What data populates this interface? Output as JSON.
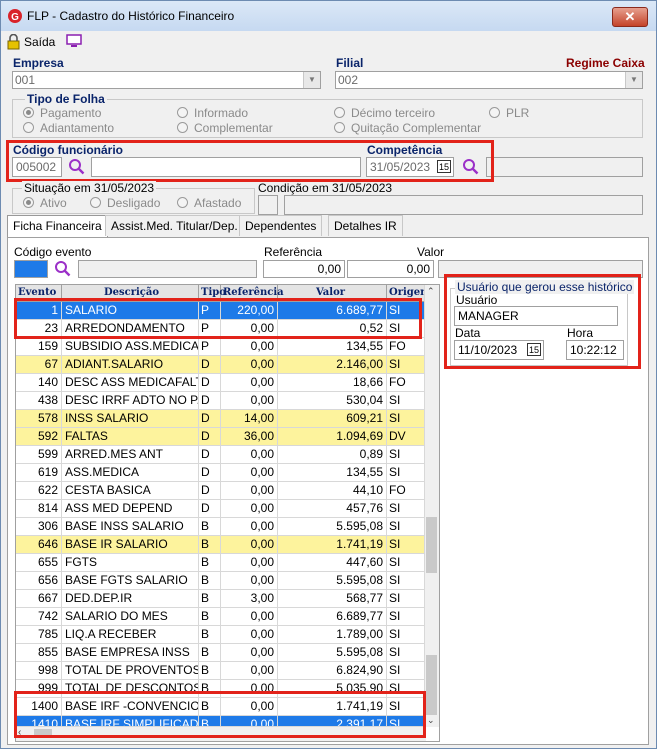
{
  "window": {
    "title": "FLP - Cadastro do Histórico Financeiro",
    "close_label": "✕"
  },
  "toolbar": {
    "exit_label": "Saída"
  },
  "empresa": {
    "label": "Empresa",
    "value": "001"
  },
  "filial": {
    "label": "Filial",
    "value": "002"
  },
  "regime": {
    "label": "Regime Caixa"
  },
  "tipo_folha": {
    "label": "Tipo de Folha",
    "options": [
      "Pagamento",
      "Informado",
      "Décimo terceiro",
      "PLR",
      "Adiantamento",
      "Complementar",
      "Quitação Complementar"
    ],
    "selected": "Pagamento"
  },
  "funcionario": {
    "label": "Código funcionário",
    "code": "005002",
    "name": ""
  },
  "competencia": {
    "label": "Competência",
    "value": "31/05/2023",
    "cal_label": "15"
  },
  "situacao": {
    "label": "Situação em 31/05/2023",
    "options": [
      "Ativo",
      "Desligado",
      "Afastado"
    ],
    "selected": "Ativo"
  },
  "condicao": {
    "label": "Condição em 31/05/2023"
  },
  "tabs": [
    "Ficha Financeira",
    "Assist.Med. Titular/Dep.",
    "Dependentes",
    "Detalhes IR"
  ],
  "evento": {
    "label": "Código evento",
    "ref_label": "Referência",
    "ref_value": "0,00",
    "valor_label": "Valor",
    "valor_value": "0,00"
  },
  "grid": {
    "columns": [
      "Evento",
      "Descrição",
      "Tipo",
      "Referência",
      "Valor",
      "Origem"
    ],
    "rows": [
      {
        "ev": "1",
        "desc": "SALARIO",
        "tipo": "P",
        "ref": "220,00",
        "valor": "6.689,77",
        "orig": "SI",
        "style": "selected"
      },
      {
        "ev": "23",
        "desc": "ARREDONDAMENTO",
        "tipo": "P",
        "ref": "0,00",
        "valor": "0,52",
        "orig": "SI",
        "style": "white"
      },
      {
        "ev": "159",
        "desc": "SUBSIDIO ASS.MEDICA",
        "tipo": "P",
        "ref": "0,00",
        "valor": "134,55",
        "orig": "FO",
        "style": "white"
      },
      {
        "ev": "67",
        "desc": "ADIANT.SALARIO",
        "tipo": "D",
        "ref": "0,00",
        "valor": "2.146,00",
        "orig": "SI",
        "style": "yellow"
      },
      {
        "ev": "140",
        "desc": "DESC ASS MEDICAFALTA",
        "tipo": "D",
        "ref": "0,00",
        "valor": "18,66",
        "orig": "FO",
        "style": "white"
      },
      {
        "ev": "438",
        "desc": "DESC IRRF ADTO NO P...",
        "tipo": "D",
        "ref": "0,00",
        "valor": "530,04",
        "orig": "SI",
        "style": "white"
      },
      {
        "ev": "578",
        "desc": "INSS SALARIO",
        "tipo": "D",
        "ref": "14,00",
        "valor": "609,21",
        "orig": "SI",
        "style": "yellow"
      },
      {
        "ev": "592",
        "desc": "FALTAS",
        "tipo": "D",
        "ref": "36,00",
        "valor": "1.094,69",
        "orig": "DV",
        "style": "yellow"
      },
      {
        "ev": "599",
        "desc": "ARRED.MES ANT",
        "tipo": "D",
        "ref": "0,00",
        "valor": "0,89",
        "orig": "SI",
        "style": "white"
      },
      {
        "ev": "619",
        "desc": "ASS.MEDICA",
        "tipo": "D",
        "ref": "0,00",
        "valor": "134,55",
        "orig": "SI",
        "style": "white"
      },
      {
        "ev": "622",
        "desc": "CESTA BASICA",
        "tipo": "D",
        "ref": "0,00",
        "valor": "44,10",
        "orig": "FO",
        "style": "white"
      },
      {
        "ev": "814",
        "desc": "ASS MED DEPEND",
        "tipo": "D",
        "ref": "0,00",
        "valor": "457,76",
        "orig": "SI",
        "style": "white"
      },
      {
        "ev": "306",
        "desc": "BASE INSS SALARIO",
        "tipo": "B",
        "ref": "0,00",
        "valor": "5.595,08",
        "orig": "SI",
        "style": "white"
      },
      {
        "ev": "646",
        "desc": "BASE IR SALARIO",
        "tipo": "B",
        "ref": "0,00",
        "valor": "1.741,19",
        "orig": "SI",
        "style": "yellow"
      },
      {
        "ev": "655",
        "desc": "FGTS",
        "tipo": "B",
        "ref": "0,00",
        "valor": "447,60",
        "orig": "SI",
        "style": "white"
      },
      {
        "ev": "656",
        "desc": "BASE FGTS SALARIO",
        "tipo": "B",
        "ref": "0,00",
        "valor": "5.595,08",
        "orig": "SI",
        "style": "white"
      },
      {
        "ev": "667",
        "desc": "DED.DEP.IR",
        "tipo": "B",
        "ref": "3,00",
        "valor": "568,77",
        "orig": "SI",
        "style": "white"
      },
      {
        "ev": "742",
        "desc": "SALARIO DO MES",
        "tipo": "B",
        "ref": "0,00",
        "valor": "6.689,77",
        "orig": "SI",
        "style": "white"
      },
      {
        "ev": "785",
        "desc": "LIQ.A RECEBER",
        "tipo": "B",
        "ref": "0,00",
        "valor": "1.789,00",
        "orig": "SI",
        "style": "white"
      },
      {
        "ev": "855",
        "desc": "BASE EMPRESA INSS",
        "tipo": "B",
        "ref": "0,00",
        "valor": "5.595,08",
        "orig": "SI",
        "style": "white"
      },
      {
        "ev": "998",
        "desc": "TOTAL DE PROVENTOS",
        "tipo": "B",
        "ref": "0,00",
        "valor": "6.824,90",
        "orig": "SI",
        "style": "white"
      },
      {
        "ev": "999",
        "desc": "TOTAL DE DESCONTOS",
        "tipo": "B",
        "ref": "0,00",
        "valor": "5.035,90",
        "orig": "SI",
        "style": "white"
      },
      {
        "ev": "1400",
        "desc": "BASE IRF -CONVENCION...",
        "tipo": "B",
        "ref": "0,00",
        "valor": "1.741,19",
        "orig": "SI",
        "style": "white"
      },
      {
        "ev": "1410",
        "desc": "BASE IRF SIMPLIFICADA",
        "tipo": "B",
        "ref": "0,00",
        "valor": "2.391,17",
        "orig": "SI",
        "style": "selected"
      }
    ]
  },
  "usuario_box": {
    "label": "Usuário que gerou esse histórico",
    "user_label": "Usuário",
    "user_value": "MANAGER",
    "date_label": "Data",
    "date_value": "11/10/2023",
    "hour_label": "Hora",
    "hour_value": "10:22:12",
    "cal_label": "15"
  },
  "colors": {
    "accent_blue": "#0a246a",
    "selected_row": "#1e7ae8",
    "yellow_row": "#fdf39d",
    "highlight_red": "#e2231a"
  }
}
